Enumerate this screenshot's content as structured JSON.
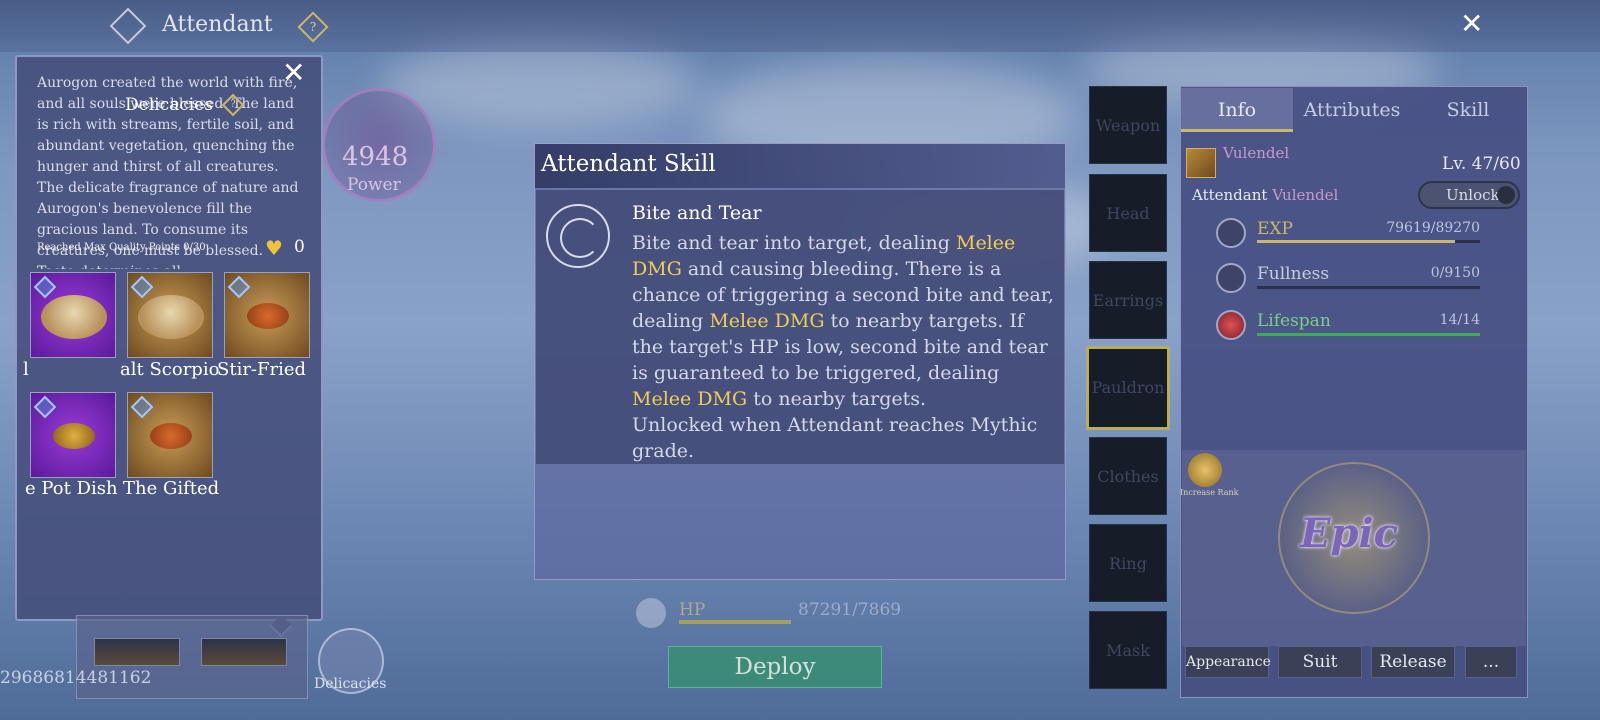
{
  "header": {
    "title": "Attendant",
    "help": "?"
  },
  "delicacies": {
    "title": "Delicacies",
    "help": "?",
    "description": "Aurogon created the world with fire, and all souls were blessed. The land is rich with streams, fertile soil, and abundant vegetation, quenching the hunger and thirst of all creatures. The delicate fragrance of nature and Aurogon's benevolence fill the gracious land. To consume its creatures, one must be blessed. Taste determines all.",
    "quality_label": "Reached Max Quality Points 0/30",
    "quality_value": "0",
    "items": [
      {
        "label": "l"
      },
      {
        "label": "alt Scorpio"
      },
      {
        "label": "Stir-Fried B"
      },
      {
        "label": "e Pot Dish"
      },
      {
        "label": "The Gifted"
      }
    ],
    "button_label": "Delicacies"
  },
  "uid": "29686814481162",
  "power": {
    "value": "4948",
    "label": "Power"
  },
  "skill_dialog": {
    "title": "Attendant Skill",
    "skill_name": "Bite and Tear",
    "text": {
      "p1": "Bite and tear into target, dealing ",
      "h1": "Melee DMG",
      "p2": " and causing bleeding. There is a chance of triggering a second bite and tear, dealing ",
      "h2": "Melee DMG",
      "p3": " to nearby targets. If the target's HP is low, second bite and tear is guaranteed to be triggered, dealing ",
      "h3": "Melee DMG",
      "p4": " to nearby targets.",
      "unlock": "Unlocked when Attendant reaches Mythic grade."
    }
  },
  "hp": {
    "label": "HP",
    "value": "87291/7869"
  },
  "deploy_label": "Deploy",
  "equipment_slots": [
    {
      "label": "Weapon"
    },
    {
      "label": "Head"
    },
    {
      "label": "Earrings"
    },
    {
      "label": "Pauldron",
      "active": true
    },
    {
      "label": "Clothes"
    },
    {
      "label": "Ring"
    },
    {
      "label": "Mask"
    }
  ],
  "right_panel": {
    "tabs": [
      {
        "label": "Info"
      },
      {
        "label": "Attributes"
      },
      {
        "label": "Skill"
      }
    ],
    "pet_name": "Vulendel",
    "level": "Lv. 47/60",
    "attendant_label": "Attendant",
    "attendant_name": "Vulendel",
    "unlock_label": "Unlock",
    "stats": [
      {
        "name": "EXP",
        "value": "79619/89270",
        "fill": 0.89
      },
      {
        "name": "Fullness",
        "value": "0/9150",
        "fill": 0
      },
      {
        "name": "Lifespan",
        "value": "14/14",
        "fill": 1
      }
    ],
    "rank_label": "Increase Rank",
    "grade": "Epic",
    "actions": [
      {
        "label": "Appearance"
      },
      {
        "label": "Suit"
      },
      {
        "label": "Release"
      },
      {
        "label": "..."
      }
    ]
  },
  "colors": {
    "highlight": "#f2cc58",
    "exp_bar": "#c9b86a",
    "lifespan_bar": "#3faa5a",
    "pet_name": "#c79ac8"
  }
}
